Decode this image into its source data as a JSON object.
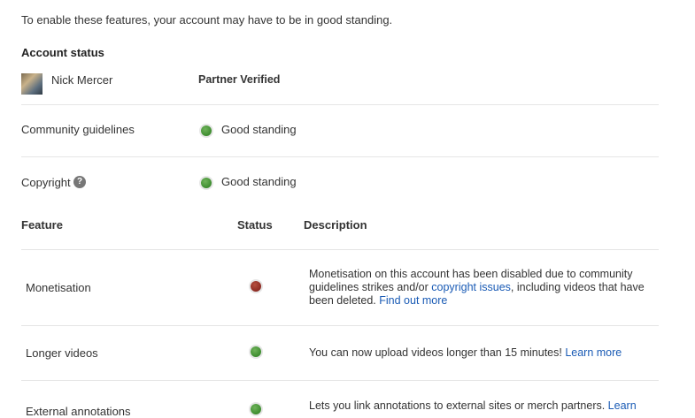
{
  "intro_text": "To enable these features, your account may have to be in good standing.",
  "account_status": {
    "heading": "Account status",
    "user_name": "Nick Mercer",
    "partner_label": "Partner Verified"
  },
  "standing": [
    {
      "label": "Community guidelines",
      "status": "Good standing",
      "color": "green"
    },
    {
      "label": "Copyright",
      "status": "Good standing",
      "color": "green"
    }
  ],
  "help_icon_glyph": "?",
  "table": {
    "headers": {
      "feature": "Feature",
      "status": "Status",
      "description": "Description"
    },
    "rows": [
      {
        "feature": "Monetisation",
        "status_color": "red",
        "desc_part1": "Monetisation on this account has been disabled due to community guidelines strikes and/or ",
        "desc_link1": "copyright issues",
        "desc_part2": ", including videos that have been deleted. ",
        "desc_link2": "Find out more"
      },
      {
        "feature": "Longer videos",
        "status_color": "green",
        "desc_part1": "You can now upload videos longer than 15 minutes! ",
        "desc_link1": "Learn more"
      },
      {
        "feature": "External annotations",
        "status_color": "green",
        "desc_part1": "Lets you link annotations to external sites or merch partners. ",
        "desc_link1": "Learn"
      }
    ]
  },
  "colors": {
    "link": "#1a5bb5",
    "green_dot": "#3d8c2f",
    "red_dot": "#8c2a22",
    "divider": "#e5e5e5"
  }
}
